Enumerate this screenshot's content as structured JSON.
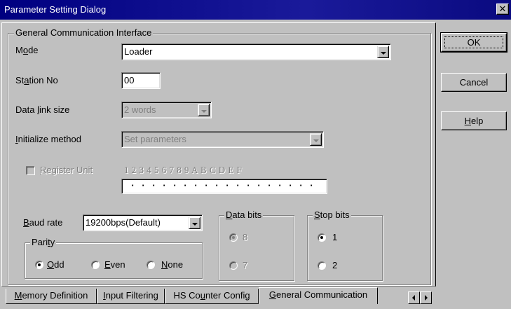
{
  "window": {
    "title": "Parameter Setting Dialog",
    "close_glyph": "✕"
  },
  "group_general": {
    "label": "General Communication Interface"
  },
  "mode": {
    "label_pre": "M",
    "label_key": "o",
    "label_post": "de",
    "value": "Loader"
  },
  "station": {
    "label_pre": "St",
    "label_key": "a",
    "label_post": "tion No",
    "value": "00"
  },
  "data_link": {
    "label_pre": "Data ",
    "label_key": "l",
    "label_post": "ink size",
    "value": "2 words",
    "enabled": false
  },
  "init_method": {
    "label_pre": "",
    "label_key": "I",
    "label_post": "nitialize method",
    "value": "Set parameters",
    "enabled": false
  },
  "register_unit": {
    "label_pre": "",
    "label_key": "R",
    "label_post": "egister Unit",
    "checked": false,
    "enabled": false,
    "digits": "1 2 3 4 5 6 7 8 9 A B C D E F",
    "dots": [
      "·",
      "·",
      "·",
      "·",
      "·",
      "·",
      "·",
      "·",
      "·",
      "·",
      "·",
      "·",
      "·",
      "·",
      "·",
      "·",
      "·",
      "·"
    ]
  },
  "baud": {
    "label_pre": "",
    "label_key": "B",
    "label_post": "aud rate",
    "value": "19200bps(Default)"
  },
  "parity": {
    "label_pre": "Pari",
    "label_key": "t",
    "label_post": "y",
    "options": [
      {
        "label": "Odd",
        "key": "O",
        "rest": "dd",
        "selected": true
      },
      {
        "label": "Even",
        "key": "E",
        "rest": "ven",
        "selected": false
      },
      {
        "label": "None",
        "key": "N",
        "rest": "one",
        "selected": false
      }
    ]
  },
  "data_bits": {
    "label_pre": "",
    "label_key": "D",
    "label_post": "ata bits",
    "enabled": false,
    "options": [
      {
        "label": "8",
        "selected": true
      },
      {
        "label": "7",
        "selected": false
      }
    ]
  },
  "stop_bits": {
    "label_pre": "",
    "label_key": "S",
    "label_post": "top bits",
    "enabled": true,
    "options": [
      {
        "label": "1",
        "selected": true
      },
      {
        "label": "2",
        "selected": false
      }
    ]
  },
  "buttons": {
    "ok": "OK",
    "cancel": "Cancel",
    "help_key": "H",
    "help_rest": "elp"
  },
  "tabs": [
    {
      "pre": "",
      "key": "M",
      "post": "emory Definition",
      "active": false
    },
    {
      "pre": "",
      "key": "I",
      "post": "nput Filtering",
      "active": false
    },
    {
      "pre": "HS Co",
      "key": "u",
      "post": "nter Config",
      "active": false
    },
    {
      "pre": "",
      "key": "G",
      "post": "eneral Communication",
      "active": true
    }
  ]
}
